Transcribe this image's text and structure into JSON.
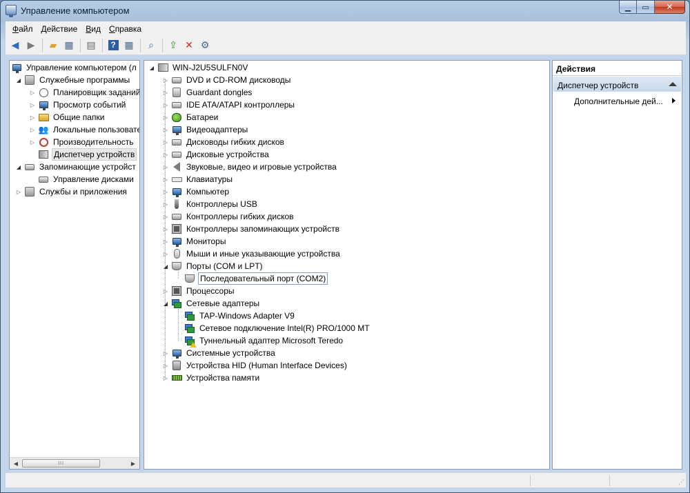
{
  "window": {
    "title": "Управление компьютером"
  },
  "menu": [
    {
      "underline": "Ф",
      "rest": "айл"
    },
    {
      "underline": "Д",
      "rest": "ействие"
    },
    {
      "underline": "В",
      "rest": "ид"
    },
    {
      "underline": "С",
      "rest": "правка"
    }
  ],
  "left_tree": {
    "root": "Управление компьютером (л",
    "system_tools": "Служебные программы",
    "task_scheduler": "Планировщик заданий",
    "event_viewer": "Просмотр событий",
    "shared_folders": "Общие папки",
    "local_users": "Локальные пользовате",
    "performance": "Производительность",
    "device_manager": "Диспетчер устройств",
    "storage": "Запоминающие устройст",
    "disk_management": "Управление дисками",
    "services": "Службы и приложения"
  },
  "device_tree": {
    "computer_name": "WIN-J2U5SULFN0V",
    "categories": [
      "DVD и CD-ROM дисководы",
      "Guardant dongles",
      "IDE ATA/ATAPI контроллеры",
      "Батареи",
      "Видеоадаптеры",
      "Дисководы гибких дисков",
      "Дисковые устройства",
      "Звуковые, видео и игровые устройства",
      "Клавиатуры",
      "Компьютер",
      "Контроллеры USB",
      "Контроллеры гибких дисков",
      "Контроллеры запоминающих устройств",
      "Мониторы",
      "Мыши и иные указывающие устройства",
      "Порты (COM и LPT)",
      "Процессоры",
      "Сетевые адаптеры",
      "Системные устройства",
      "Устройства HID (Human Interface Devices)",
      "Устройства памяти"
    ],
    "ports_children": [
      "Последовательный порт (COM2)"
    ],
    "network_children": [
      "TAP-Windows Adapter V9",
      "Сетевое подключение Intel(R) PRO/1000 MT",
      "Туннельный адаптер Microsoft Teredo"
    ]
  },
  "actions": {
    "header": "Действия",
    "section": "Диспетчер устройств",
    "more": "Дополнительные дей..."
  },
  "scroll_grip": "III"
}
